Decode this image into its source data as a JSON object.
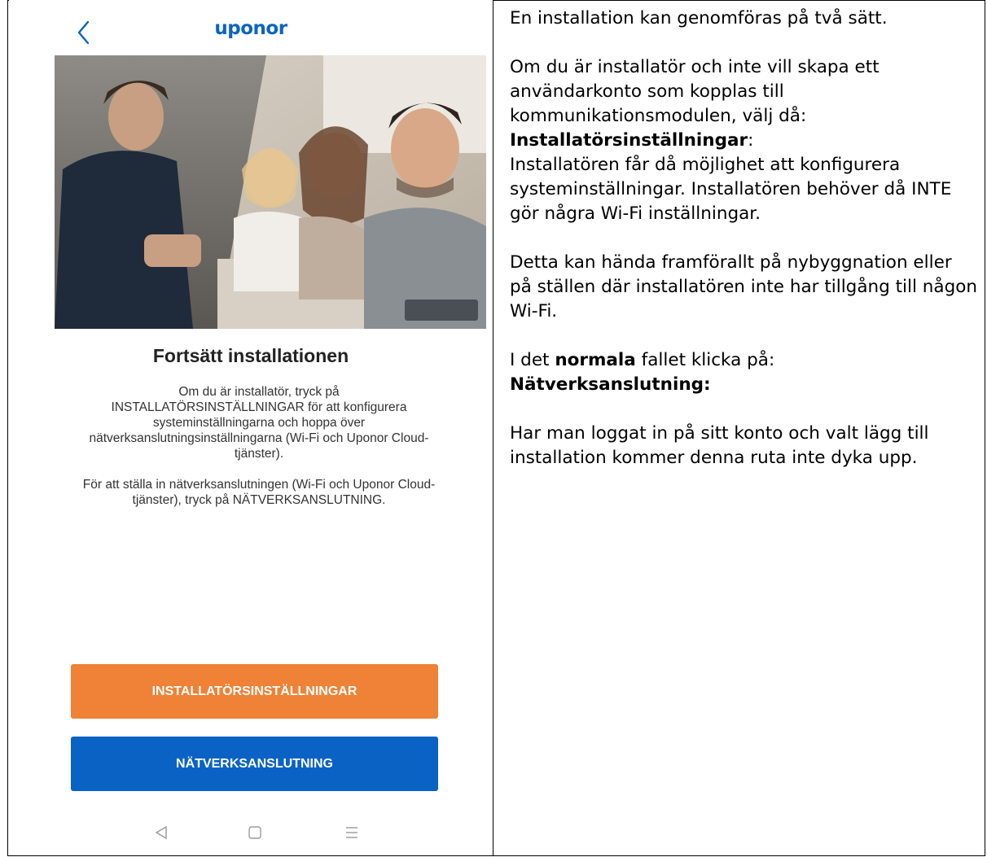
{
  "app": {
    "logo_text": "uponor",
    "back_icon": "chevron-left-icon",
    "accent_color": "#0b64c0"
  },
  "screen": {
    "title": "Fortsätt installationen",
    "paragraph1": "Om du är installatör, tryck på INSTALLATÖRSINSTÄLLNINGAR för att konfigurera systeminställningarna och hoppa över nätverksanslutningsinställningarna (Wi-Fi och Uponor Cloud-tjänster).",
    "paragraph2": "För att ställa in nätverksanslutningen (Wi-Fi och Uponor Cloud-tjänster), tryck på NÄTVERKSANSLUTNING."
  },
  "buttons": {
    "installer_label": "INSTALLATÖRSINSTÄLLNINGAR",
    "installer_color": "#ef8236",
    "network_label": "NÄTVERKSANSLUTNING",
    "network_color": "#0a62c4"
  },
  "navbar": {
    "back": "back-triangle-icon",
    "home": "home-square-icon",
    "menu": "menu-lines-icon"
  },
  "notes": {
    "line1": "En installation kan genomföras på två sätt.",
    "line2": "Om du är installatör och inte vill skapa ett användarkonto som kopplas till kommunikationsmodulen, välj då:",
    "line3_bold": "Installatörsinställningar",
    "line3_tail": ":",
    "line4": "Installatören får då möjlighet att konfigurera systeminställningar. Installatören behöver då INTE gör några Wi-Fi inställningar.",
    "line5": "Detta kan hända framförallt på nybyggnation eller på ställen där installatören inte har tillgång till någon Wi-Fi.",
    "line6_pre": "I det ",
    "line6_bold": "normala",
    "line6_post": " fallet klicka på:",
    "line7_bold": "Nätverksanslutning:",
    "line8": "Har man loggat in på sitt konto och valt lägg till installation kommer denna ruta inte dyka upp."
  }
}
